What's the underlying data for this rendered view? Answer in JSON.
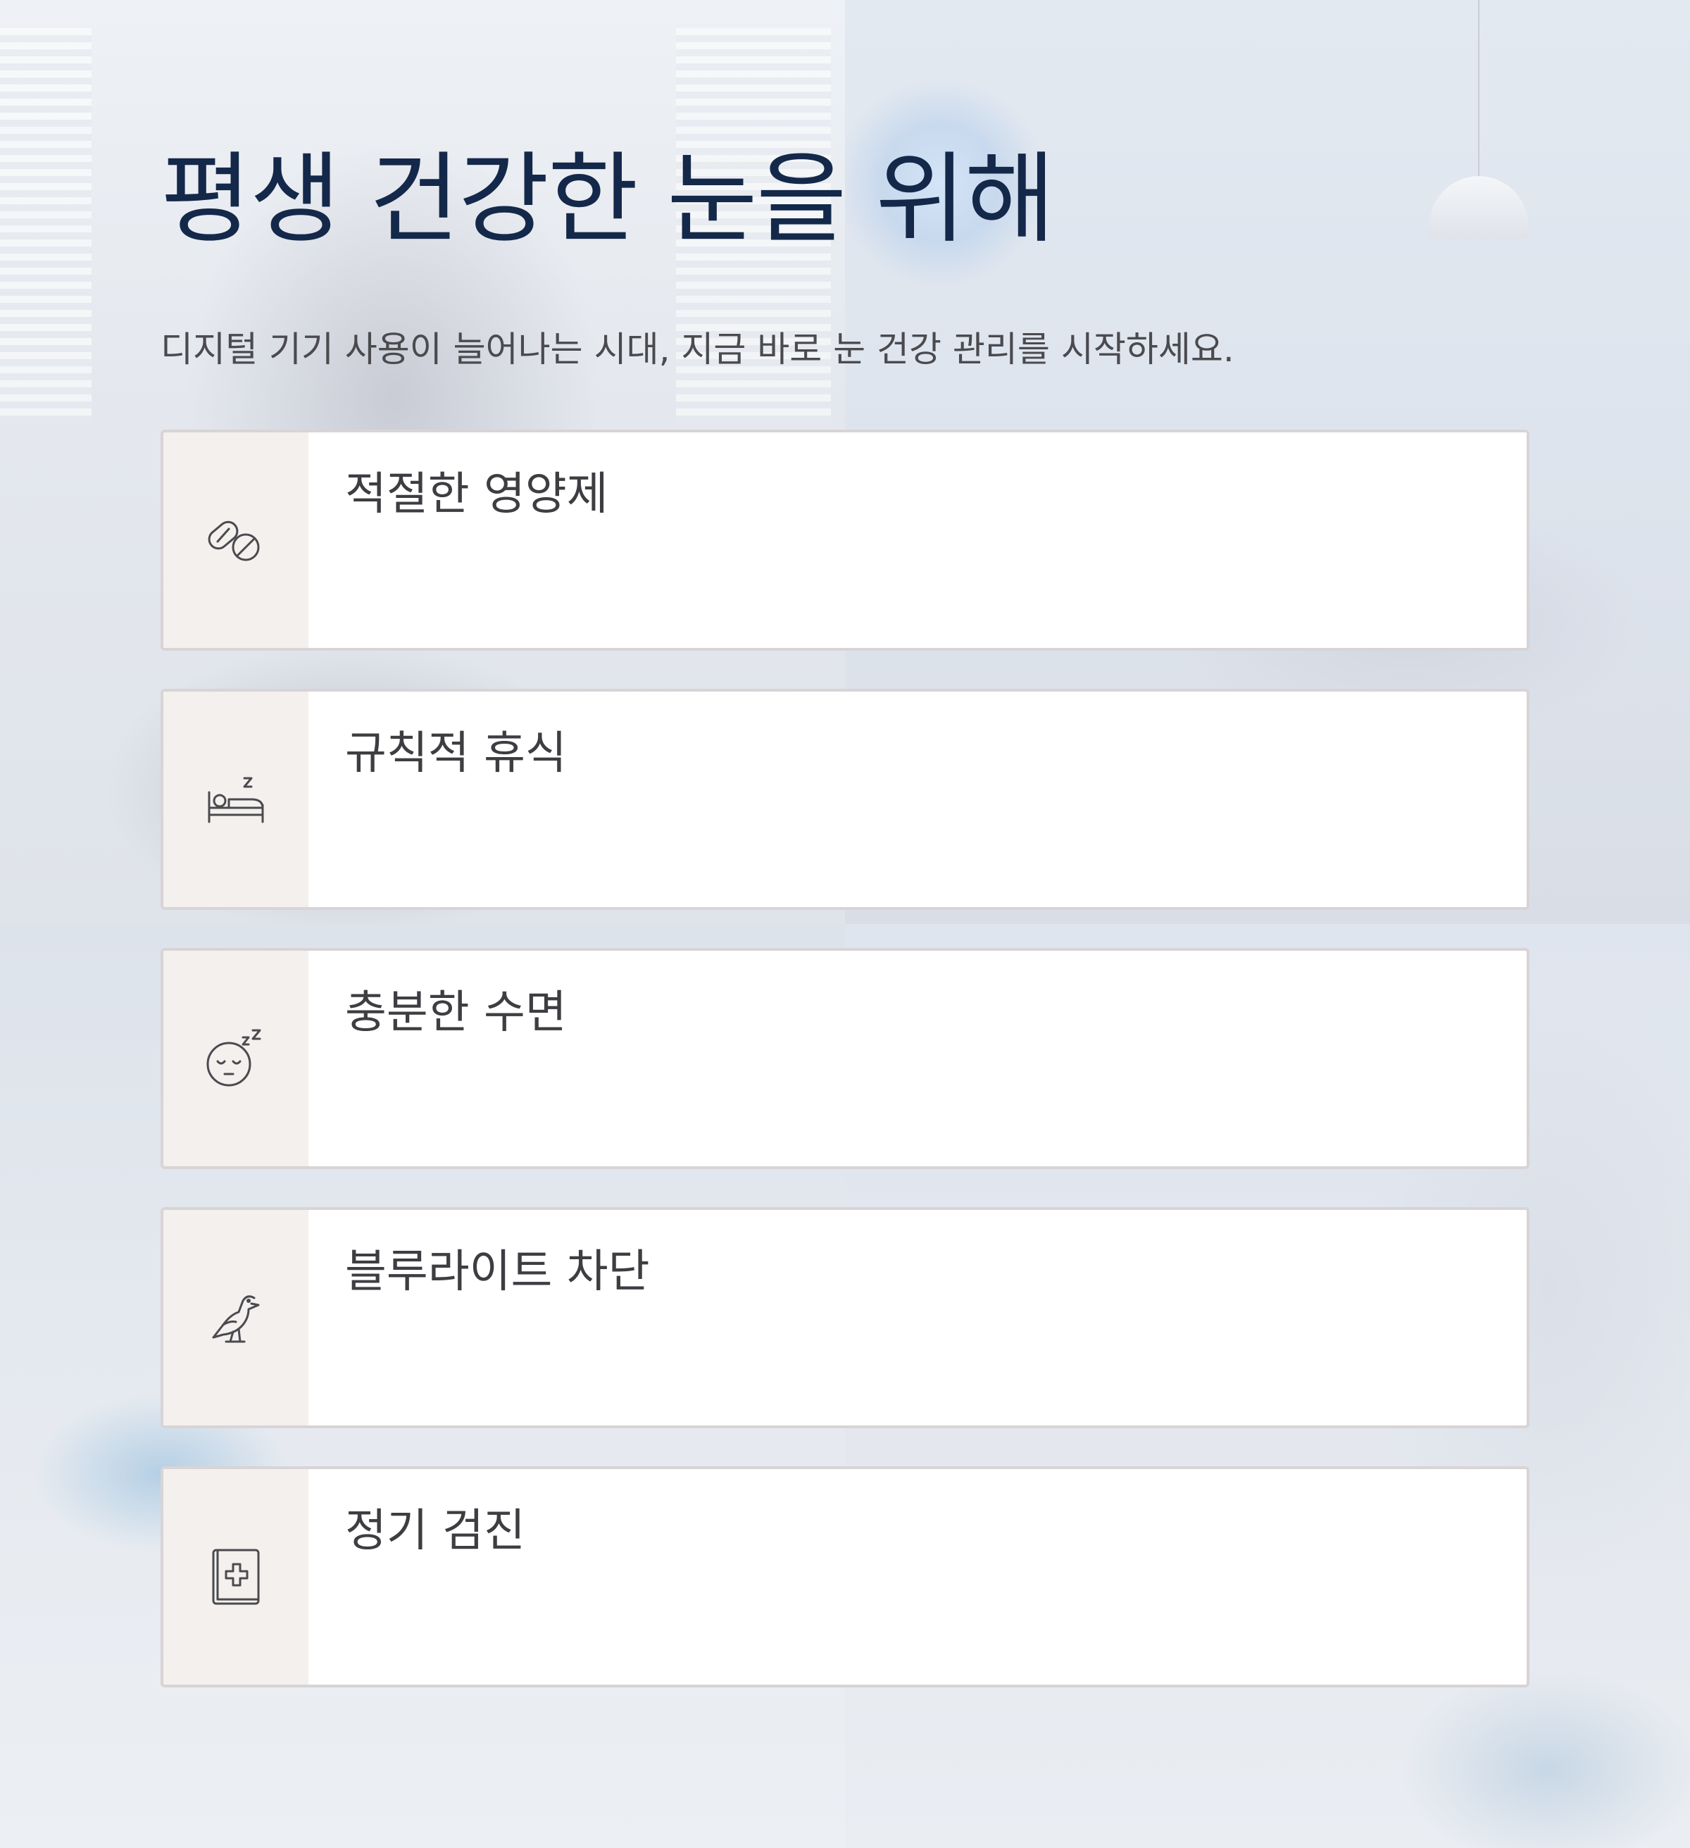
{
  "header": {
    "title": "평생 건강한 눈을 위해",
    "subtitle": "디지털 기기 사용이 늘어나는 시대, 지금 바로 눈 건강 관리를 시작하세요."
  },
  "cards": [
    {
      "icon": "pills-icon",
      "title": "적절한 영양제"
    },
    {
      "icon": "bed-icon",
      "title": "규칙적 휴식"
    },
    {
      "icon": "sleeping-face-icon",
      "title": "충분한 수면"
    },
    {
      "icon": "bird-icon",
      "title": "블루라이트 차단"
    },
    {
      "icon": "medical-book-icon",
      "title": "정기 검진"
    }
  ],
  "colors": {
    "title": "#14284a",
    "text": "#4a4a4f",
    "card_border": "#d8d4d6",
    "icon_column": "#f3f0ee"
  }
}
